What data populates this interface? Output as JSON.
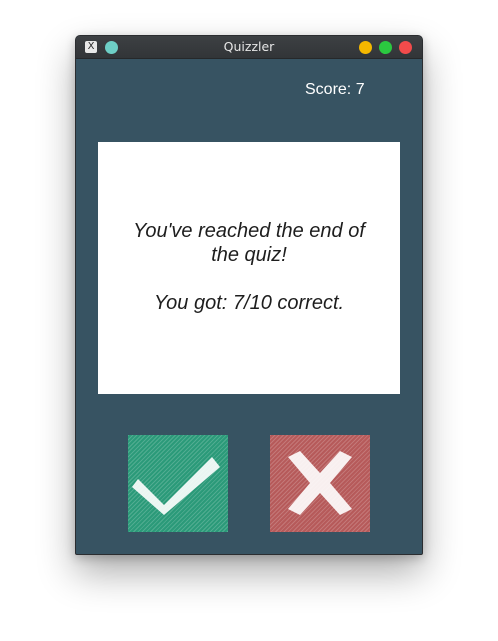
{
  "window": {
    "title": "Quizzler",
    "app_icon": "X"
  },
  "score": {
    "label": "Score: 7"
  },
  "question_card": {
    "line1": "You've reached the end of",
    "line2": "the quiz!",
    "line3": "You got: 7/10 correct."
  },
  "buttons": {
    "true_icon": "checkmark-icon",
    "false_icon": "cross-icon"
  },
  "colors": {
    "background": "#375362",
    "true_button": "#2b9a79",
    "false_button": "#b65a5a",
    "card": "#ffffff"
  }
}
